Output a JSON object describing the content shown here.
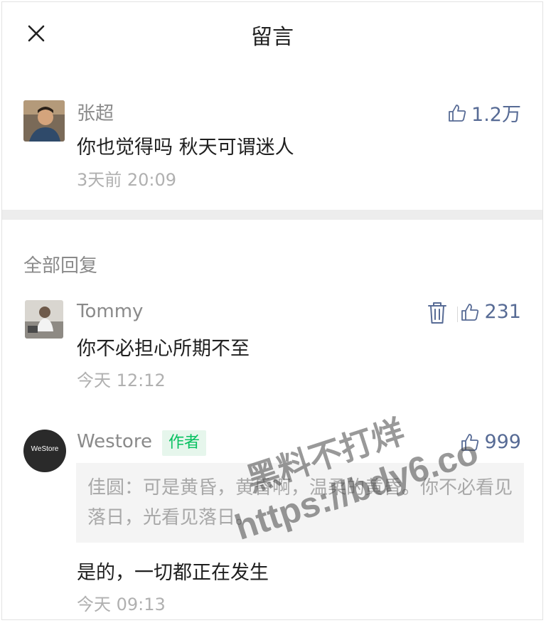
{
  "header": {
    "title": "留言"
  },
  "main_comment": {
    "user": "张超",
    "text": "你也觉得吗 秋天可谓迷人",
    "time": "3天前 20:09",
    "likes": "1.2万"
  },
  "replies_label": "全部回复",
  "replies": [
    {
      "user": "Tommy",
      "text": "你不必担心所期不至",
      "time": "今天 12:12",
      "likes": "231"
    },
    {
      "user": "Westore",
      "badge": "作者",
      "avatar_text": "WeStore",
      "quote": "佳圆：可是黄昏，黄昏啊，温柔的黄昏。你不必看见落日，光看见落日。",
      "text": "是的，一切都正在发生",
      "time": "今天 09:13",
      "likes": "999"
    }
  ],
  "watermark": {
    "line1": "黑料不打烊",
    "line2": "https://bdy6.co"
  },
  "colors": {
    "accent": "#576b95",
    "badge": "#07c160",
    "separator": "#ededed"
  }
}
